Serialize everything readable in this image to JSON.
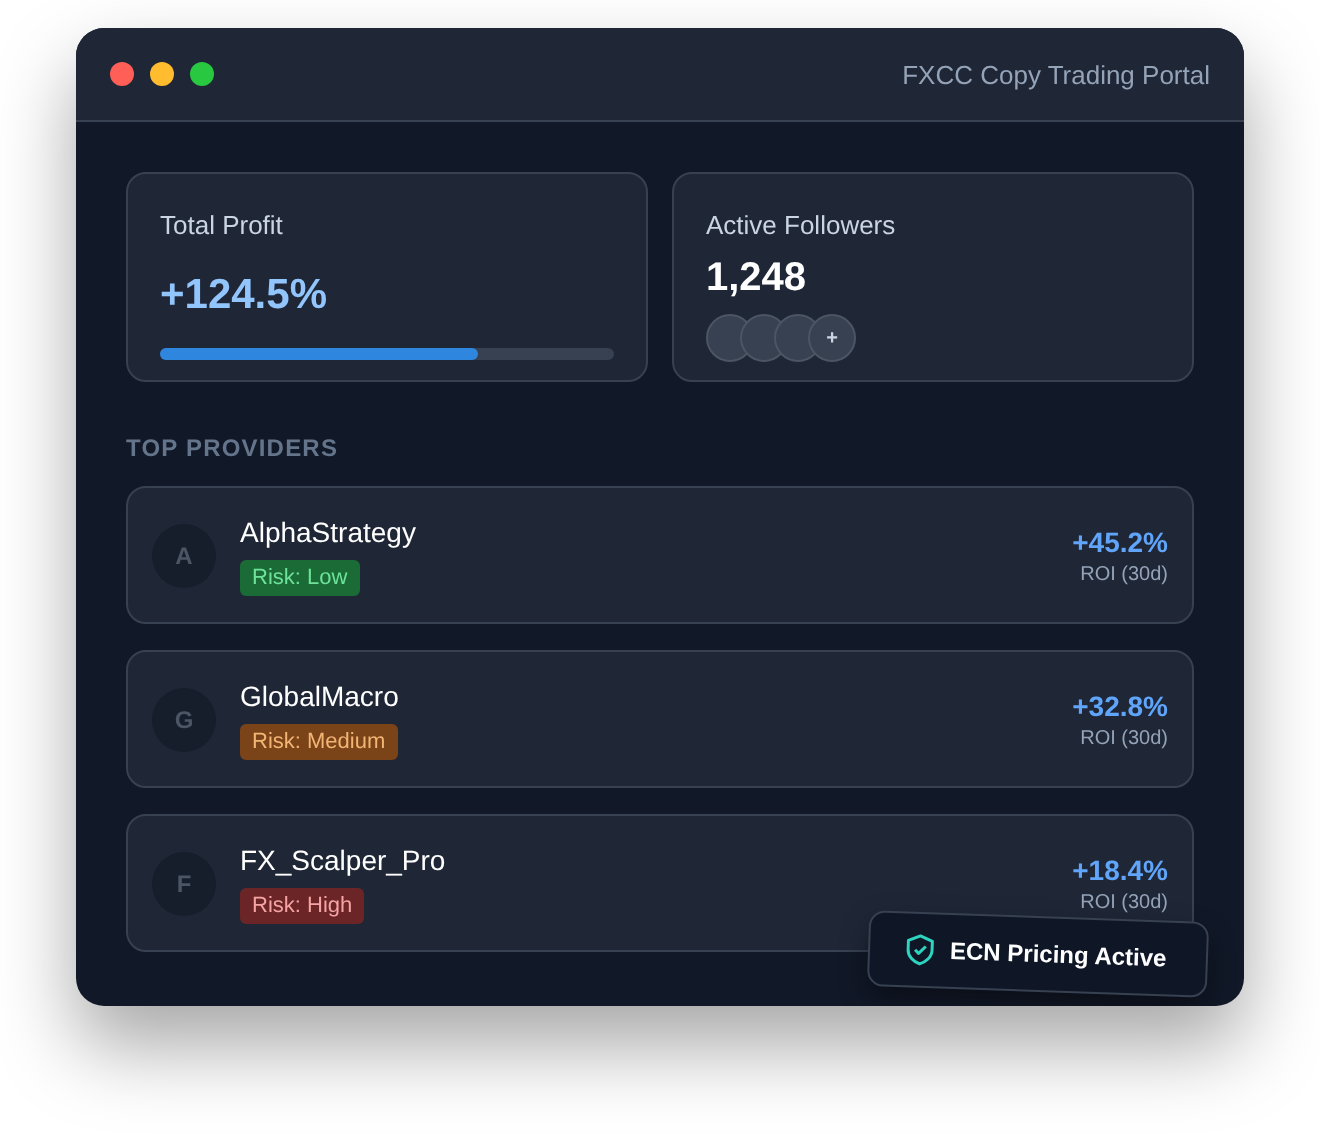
{
  "window": {
    "title": "FXCC Copy Trading Portal"
  },
  "stats": {
    "profit": {
      "label": "Total Profit",
      "value": "+124.5%",
      "level": 0.7
    },
    "followers": {
      "label": "Active Followers",
      "value": "1,248",
      "avatars": [
        {
          "kind": "blank"
        },
        {
          "kind": "blank"
        },
        {
          "kind": "blank"
        }
      ],
      "more": "+"
    }
  },
  "section_title": "TOP PROVIDERS",
  "providers": [
    {
      "initial": "A",
      "name": "AlphaStrategy",
      "risk": "Risk: Low",
      "kind": "low",
      "roi": "+45.2%",
      "roi_label": "ROI (30d)"
    },
    {
      "initial": "G",
      "name": "GlobalMacro",
      "risk": "Risk: Medium",
      "kind": "medium",
      "roi": "+32.8%",
      "roi_label": "ROI (30d)"
    },
    {
      "initial": "F",
      "name": "FX_Scalper_Pro",
      "risk": "Risk: High",
      "kind": "high",
      "roi": "+18.4%",
      "roi_label": "ROI (30d)"
    }
  ],
  "badge": {
    "label": "ECN Pricing Active"
  }
}
